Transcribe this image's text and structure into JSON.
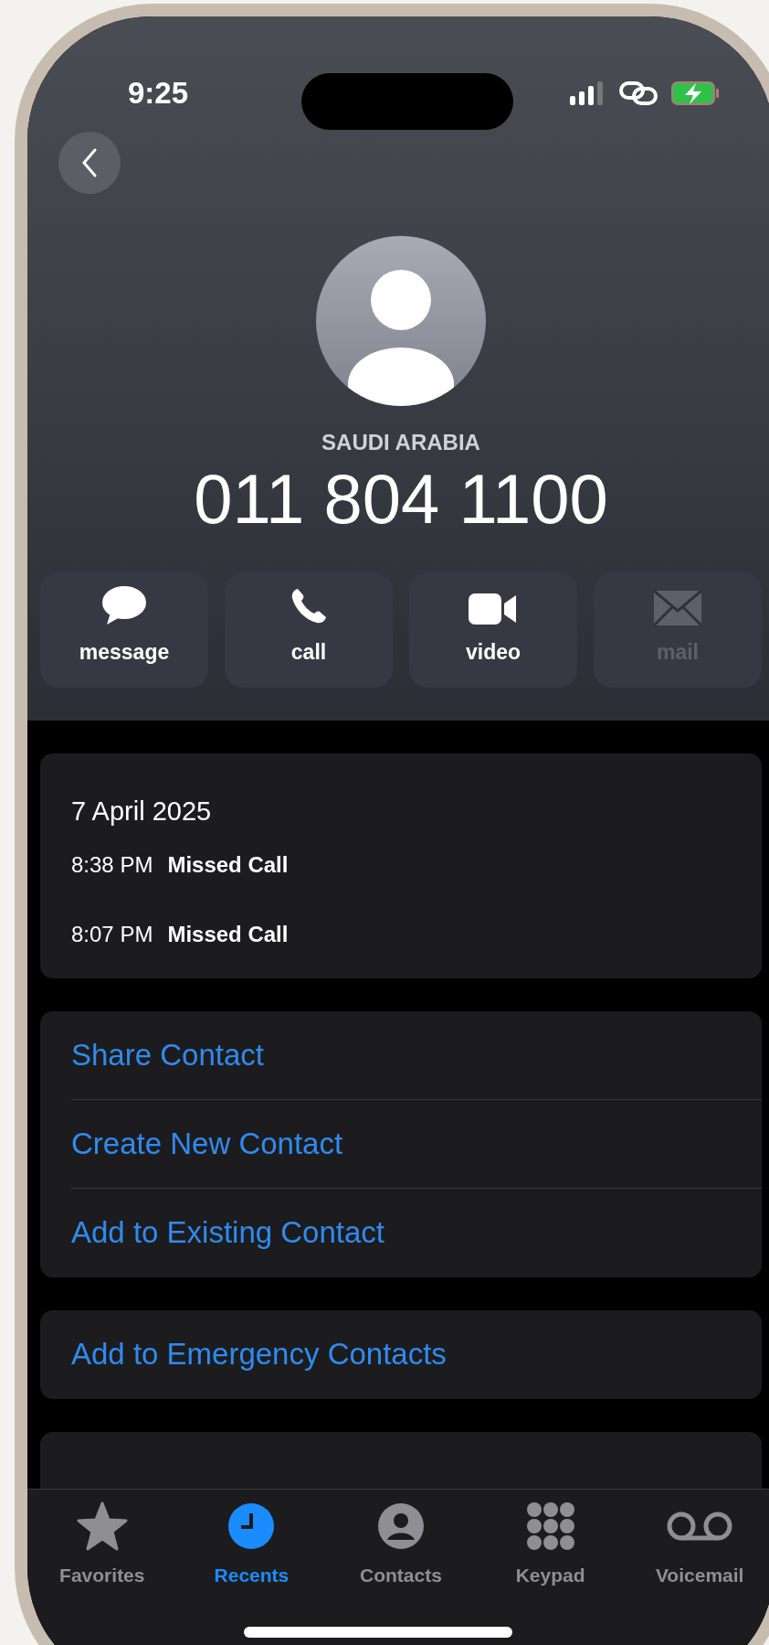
{
  "status_bar": {
    "time": "9:25"
  },
  "contact": {
    "country": "SAUDI ARABIA",
    "number": "011 804 1100"
  },
  "actions": [
    {
      "kind": "message",
      "label": "message",
      "disabled": false
    },
    {
      "kind": "call",
      "label": "call",
      "disabled": false
    },
    {
      "kind": "video",
      "label": "video",
      "disabled": false
    },
    {
      "kind": "mail",
      "label": "mail",
      "disabled": true
    }
  ],
  "call_history": {
    "date": "7 April 2025",
    "calls": [
      {
        "time": "8:38 PM",
        "type": "Missed Call"
      },
      {
        "time": "8:07 PM",
        "type": "Missed Call"
      }
    ]
  },
  "contact_actions": [
    "Share Contact",
    "Create New Contact",
    "Add to Existing Contact"
  ],
  "emergency_actions": [
    "Add to Emergency Contacts"
  ],
  "tab_bar": [
    {
      "kind": "favorites",
      "label": "Favorites",
      "selected": false
    },
    {
      "kind": "recents",
      "label": "Recents",
      "selected": true
    },
    {
      "kind": "contacts",
      "label": "Contacts",
      "selected": false
    },
    {
      "kind": "keypad",
      "label": "Keypad",
      "selected": false
    },
    {
      "kind": "voicemail",
      "label": "Voicemail",
      "selected": false
    }
  ]
}
